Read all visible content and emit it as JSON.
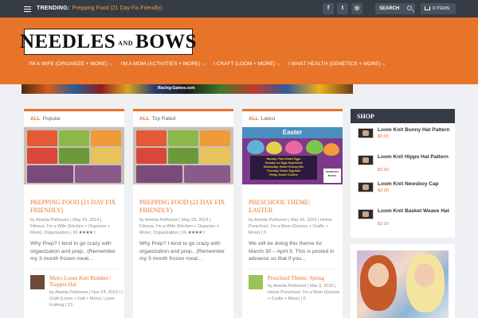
{
  "topbar": {
    "trending_label": "TRENDING:",
    "trending_link": "Prepping Food (21 Day Fix Friendly)",
    "social": [
      {
        "icon": "facebook-icon",
        "glyph": "f"
      },
      {
        "icon": "twitter-icon",
        "glyph": "t"
      },
      {
        "icon": "instagram-icon",
        "glyph": "◎"
      },
      {
        "icon": "rss-icon",
        "glyph": "⌇"
      }
    ],
    "search_label": "SEARCH",
    "cart_label": "0 ITEMS"
  },
  "header": {
    "logo_left": "NEEDLES",
    "logo_and": "AND",
    "logo_right": "BOWS",
    "nav": [
      "I'M A WIFE (ORGANIZE + MORE)",
      "I'M A MOM (ACTIVITIES + MORE)",
      "I CRAFT (LOOM + MORE)",
      "I WANT HEALTH (GENETICS + MORE)"
    ],
    "banner_text": "Racing-Games.com"
  },
  "colors": {
    "accent": "#e8742a",
    "dark": "#353c46"
  },
  "cards": [
    {
      "tab_all": "ALL",
      "tab_label": "Popular",
      "title": "PREPPING FOOD (21 DAY FIX FRIENDLY)",
      "meta": "by Amelia Pothoven | May 29, 2014 | Fitness, I'm a Wife (Kitchen + Organize + More), Organization | 16",
      "rating_stars": "★★★★☆",
      "excerpt": "Why Prep? I tend to go crazy with organization and prep.. (Remember my 3 month frozen meal...",
      "mini_title": "Men's Loom Knit Bomber / Trapper Hat",
      "mini_meta": "by Amelia Pothoven | Nov 24, 2013 | I Craft (Loom + Felt + More), Loom Knitting | 13"
    },
    {
      "tab_all": "ALL",
      "tab_label": "Top Rated",
      "title": "PREPPING FOOD (21 DAY FIX FRIENDLY)",
      "meta": "by Amelia Pothoven | May 29, 2014 | Fitness, I'm a Wife (Kitchen + Organize + More), Organization | 16",
      "rating_stars": "★★★★☆",
      "excerpt": "Why Prep? I tend to go crazy with organization and prep.. (Remember my 3 month frozen meal...",
      "mini_title": "",
      "mini_meta": ""
    },
    {
      "tab_all": "ALL",
      "tab_label": "Latest",
      "title": "PRESCHOOL THEME: EASTER",
      "meta": "by Amelia Pothoven | Mar 16, 2015 | Home Preschool, I'm a Mom (Games + Crafts + More) | 0",
      "rating_stars": "",
      "excerpt": "We will be doing this theme for March 30 – April 3. This is posted in advance so that if you...",
      "mini_title": "Preschool Theme: Spring",
      "mini_meta": "by Amelia Pothoven | Mar 9, 2015 | Home Preschool, I'm a Mom (Games + Crafts + More) | 0"
    }
  ],
  "easter_image": {
    "heading": "Easter",
    "lines": [
      "Monday: Paint Easter Eggs",
      "Tuesday: Ice Eggs Experiment",
      "Wednesday: Easter Sensory Bin",
      "Thursday: Easter Egg Hunt",
      "Friday: Easter Cookies"
    ],
    "badge_top": "NEEDLES",
    "badge_bottom": "BOWS"
  },
  "shop": {
    "title": "SHOP",
    "products": [
      {
        "name": "Loom Knit Bunny Hat Pattern",
        "price": "$3.00"
      },
      {
        "name": "Loom Knit Hippo Hat Pattern",
        "price": "$3.00"
      },
      {
        "name": "Loom Knit Newsboy Cap",
        "price": "$3.00"
      },
      {
        "name": "Loom Knit Basket Weave Hat",
        "price": "$3.00"
      }
    ]
  }
}
